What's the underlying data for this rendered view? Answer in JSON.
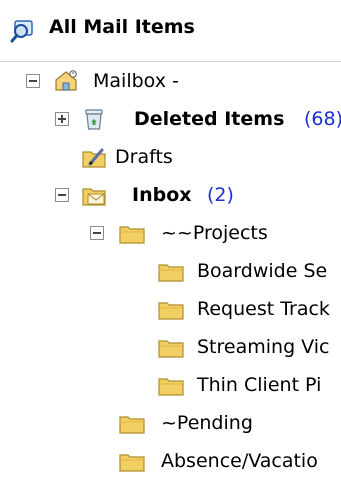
{
  "header": {
    "title": "All Mail Items",
    "icon": "search-folder-icon"
  },
  "tree": {
    "mailbox": {
      "label": "Mailbox -",
      "icon": "mailbox-icon"
    },
    "deleted": {
      "label": "Deleted Items",
      "count": "(68)",
      "icon": "recycle-bin-icon"
    },
    "drafts": {
      "label": "Drafts",
      "icon": "drafts-icon"
    },
    "inbox": {
      "label": "Inbox",
      "count": "(2)",
      "icon": "inbox-icon"
    },
    "projects": {
      "label": "~~Projects",
      "icon": "folder-icon"
    },
    "boardwide": {
      "label": "Boardwide Se",
      "icon": "folder-icon"
    },
    "request": {
      "label": "Request Track",
      "icon": "folder-icon"
    },
    "streaming": {
      "label": "Streaming Vic",
      "icon": "folder-icon"
    },
    "thin_client": {
      "label": "Thin Client Pi",
      "icon": "folder-icon"
    },
    "pending": {
      "label": "~Pending",
      "icon": "folder-icon"
    },
    "absence": {
      "label": "Absence/Vacatio",
      "icon": "folder-icon"
    }
  },
  "colors": {
    "count": "#1a2fd6",
    "folder": "#f2cf63",
    "divider": "#cfd6df"
  }
}
